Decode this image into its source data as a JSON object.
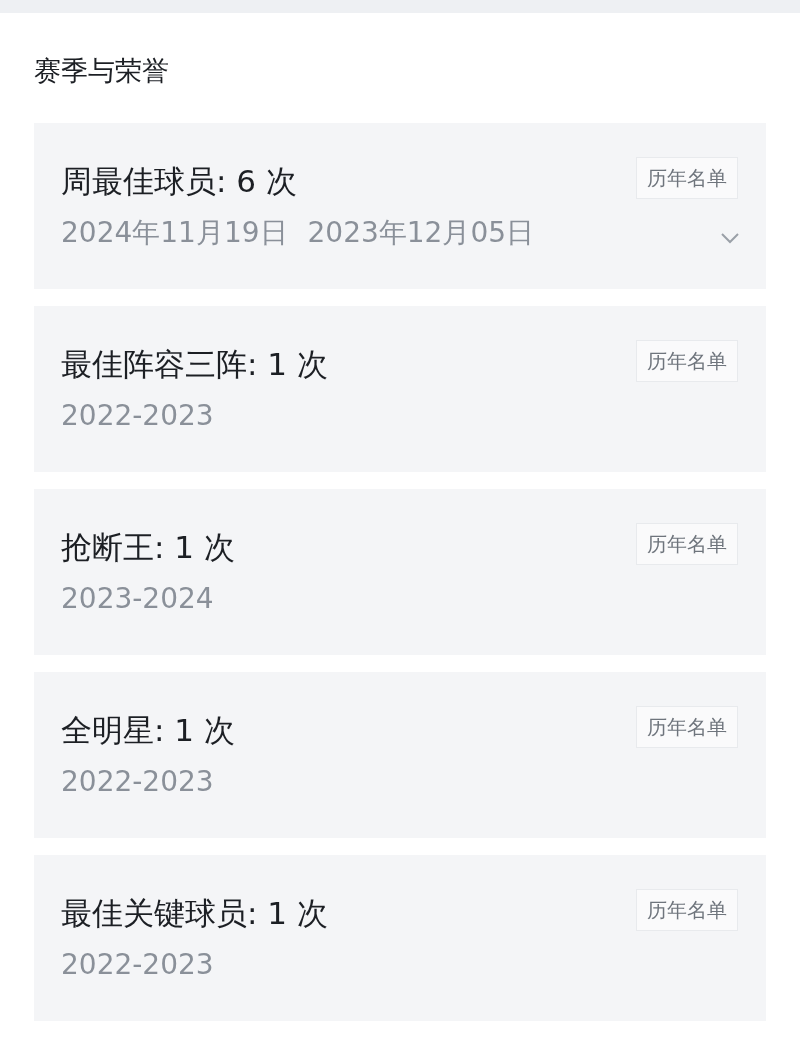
{
  "section_title": "赛季与荣誉",
  "honors": [
    {
      "title": "周最佳球员: 6 次",
      "button": "历年名单",
      "details": [
        "2024年11月19日",
        "2023年12月05日"
      ],
      "expanded": false
    },
    {
      "title": "最佳阵容三阵: 1 次",
      "button": "历年名单",
      "details": [
        "2022-2023"
      ]
    },
    {
      "title": "抢断王: 1 次",
      "button": "历年名单",
      "details": [
        "2023-2024"
      ]
    },
    {
      "title": "全明星: 1 次",
      "button": "历年名单",
      "details": [
        "2022-2023"
      ]
    },
    {
      "title": "最佳关键球员: 1 次",
      "button": "历年名单",
      "details": [
        "2022-2023"
      ]
    }
  ]
}
